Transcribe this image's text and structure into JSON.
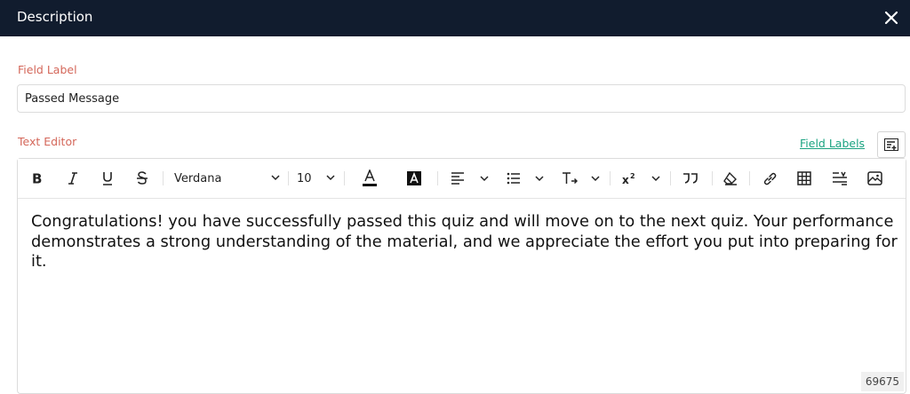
{
  "header": {
    "title": "Description"
  },
  "field": {
    "label": "Field Label",
    "value": "Passed Message"
  },
  "editor": {
    "label": "Text Editor",
    "field_labels_link": "Field Labels",
    "font_family": "Verdana",
    "font_size": "10",
    "content": "Congratulations! you have successfully passed this quiz and will move on to the next quiz. Your performance demonstrates a strong understanding of the material, and we appreciate the effort you put into preparing for it.",
    "counter": "69675"
  },
  "toolbar": {
    "icons": [
      "bold-icon",
      "italic-icon",
      "underline-icon",
      "strikethrough-icon",
      "font-color-icon",
      "highlight-color-icon",
      "align-left-icon",
      "bulleted-list-icon",
      "text-direction-icon",
      "superscript-icon",
      "blockquote-icon",
      "clear-format-icon",
      "link-icon",
      "table-icon",
      "line-height-icon",
      "image-icon"
    ]
  },
  "colors": {
    "header_bg": "#111c2e",
    "label": "#d4675a",
    "link": "#1aa381"
  }
}
